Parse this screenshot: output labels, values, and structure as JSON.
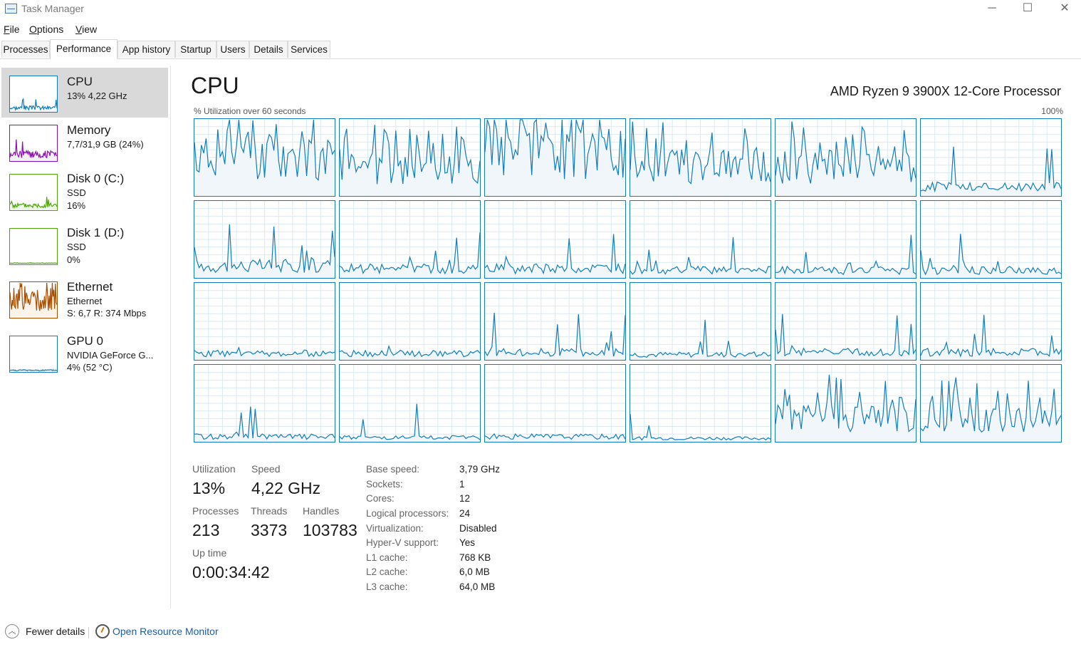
{
  "window": {
    "title": "Task Manager",
    "buttons": {
      "minimize": "─",
      "maximize": "☐",
      "close": "✕"
    }
  },
  "menu": [
    "File",
    "Options",
    "View"
  ],
  "tabs": [
    "Processes",
    "Performance",
    "App history",
    "Startup",
    "Users",
    "Details",
    "Services"
  ],
  "active_tab": "Performance",
  "sidebar": [
    {
      "title": "CPU",
      "lines": [
        "13% 4,22 GHz"
      ],
      "color": "#117dbb",
      "fill": "#f1f6fa",
      "icon": "cpu-graph-icon",
      "selected": true,
      "level": 0.13
    },
    {
      "title": "Memory",
      "lines": [
        "7,7/31,9 GB (24%)"
      ],
      "color": "#8b12ae",
      "fill": "#f4f2f4",
      "icon": "memory-graph-icon",
      "selected": false,
      "level": 0.24
    },
    {
      "title": "Disk 0 (C:)",
      "lines": [
        "SSD",
        "16%"
      ],
      "color": "#4da60c",
      "fill": "#eff7e8",
      "icon": "disk-graph-icon",
      "selected": false,
      "level": 0.16
    },
    {
      "title": "Disk 1 (D:)",
      "lines": [
        "SSD",
        "0%"
      ],
      "color": "#4da60c",
      "fill": "#eff7e8",
      "icon": "disk-graph-icon",
      "selected": false,
      "level": 0.0
    },
    {
      "title": "Ethernet",
      "lines": [
        "Ethernet",
        "S: 6,7 R: 374 Mbps"
      ],
      "color": "#a74f01",
      "fill": "#fcf3eb",
      "icon": "ethernet-graph-icon",
      "selected": false,
      "level": 0.6
    },
    {
      "title": "GPU 0",
      "lines": [
        "NVIDIA GeForce G...",
        "4% (52 °C)"
      ],
      "color": "#117dbb",
      "fill": "#f1f6fa",
      "icon": "gpu-graph-icon",
      "selected": false,
      "level": 0.04
    }
  ],
  "main": {
    "title": "CPU",
    "processor": "AMD Ryzen 9 3900X 12-Core Processor",
    "graph_label": "% Utilization over 60 seconds",
    "graph_max": "100%",
    "graph_line_color": "#117dbb",
    "graph_fill_color": "#f1f6fa",
    "graph_grid_color": "#d9eaf4"
  },
  "stats": {
    "utilization": {
      "label": "Utilization",
      "value": "13%"
    },
    "speed": {
      "label": "Speed",
      "value": "4,22 GHz"
    },
    "processes": {
      "label": "Processes",
      "value": "213"
    },
    "threads": {
      "label": "Threads",
      "value": "3373"
    },
    "handles": {
      "label": "Handles",
      "value": "103783"
    },
    "uptime": {
      "label": "Up time",
      "value": "0:00:34:42"
    }
  },
  "details": [
    {
      "k": "Base speed:",
      "v": "3,79 GHz"
    },
    {
      "k": "Sockets:",
      "v": "1"
    },
    {
      "k": "Cores:",
      "v": "12"
    },
    {
      "k": "Logical processors:",
      "v": "24"
    },
    {
      "k": "Virtualization:",
      "v": "Disabled"
    },
    {
      "k": "Hyper-V support:",
      "v": "Yes"
    },
    {
      "k": "L1 cache:",
      "v": "768 KB"
    },
    {
      "k": "L2 cache:",
      "v": "6,0 MB"
    },
    {
      "k": "L3 cache:",
      "v": "64,0 MB"
    }
  ],
  "footer": {
    "fewer_details": "Fewer details",
    "open_resource_monitor": "Open Resource Monitor"
  },
  "core_levels": [
    0.65,
    0.45,
    0.7,
    0.5,
    0.5,
    0.15,
    0.2,
    0.15,
    0.15,
    0.12,
    0.12,
    0.12,
    0.1,
    0.1,
    0.12,
    0.08,
    0.12,
    0.12,
    0.08,
    0.06,
    0.08,
    0.05,
    0.4,
    0.4
  ]
}
